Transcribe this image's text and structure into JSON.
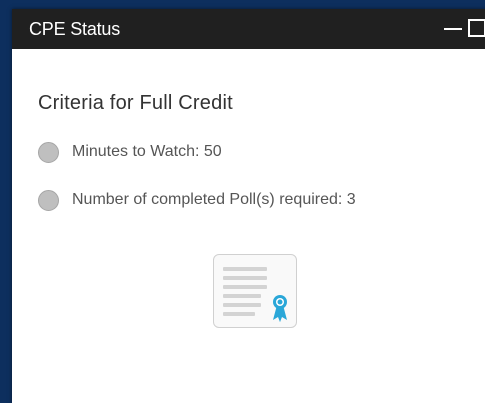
{
  "window": {
    "title": "CPE Status",
    "controls": [
      "minimize-icon",
      "maximize-icon"
    ]
  },
  "criteria": {
    "heading": "Criteria for Full Credit",
    "items": [
      {
        "label": "Minutes to Watch: 50"
      },
      {
        "label": "Number of completed Poll(s) required: 3"
      }
    ]
  },
  "certificate": {
    "icon": "certificate-icon"
  },
  "colors": {
    "background": "#0d2f5e",
    "titlebar": "#202020",
    "status_circle": "#bfbfbf",
    "ribbon": "#2aa7d8"
  }
}
